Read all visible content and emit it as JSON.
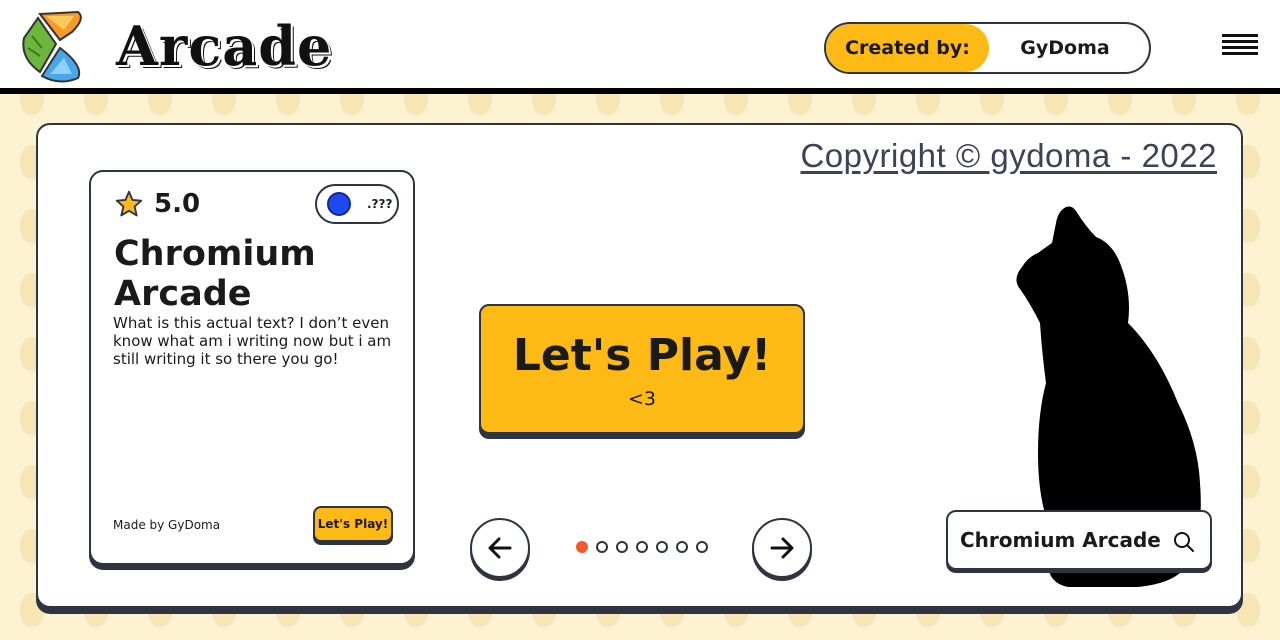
{
  "header": {
    "logo_text": "Arcade",
    "created_by_label": "Created by:",
    "created_by_name": "GyDoma"
  },
  "panel": {
    "copyright": "Copyright © gydoma - 2022"
  },
  "card": {
    "rating": "5.0",
    "pill_text": ".???",
    "title": "Chromium Arcade",
    "description": "What is this actual text? I don’t even know what am i writing now but i am still writing it so there you go!",
    "made_by": "Made by GyDoma",
    "play_label": "Let's Play!"
  },
  "hero": {
    "play_label": "Let's Play!",
    "play_sub": "<3"
  },
  "carousel": {
    "total_dots": 7,
    "active_index": 0
  },
  "search": {
    "value": "Chromium Arcade"
  },
  "colors": {
    "accent": "#fdb914",
    "dot_active": "#f05a2c",
    "pill_dot": "#1c49f0",
    "background": "#fdf3d2"
  }
}
